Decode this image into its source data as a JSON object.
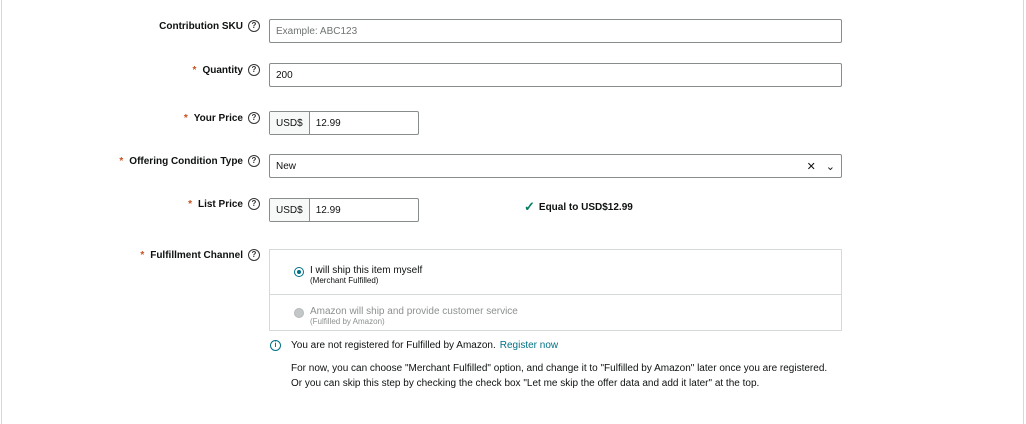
{
  "fields": {
    "sku": {
      "label": "Contribution SKU",
      "placeholder": "Example: ABC123"
    },
    "quantity": {
      "label": "Quantity",
      "value": "200"
    },
    "your_price": {
      "label": "Your Price",
      "currency": "USD$",
      "value": "12.99"
    },
    "condition": {
      "label": "Offering Condition Type",
      "value": "New"
    },
    "list_price": {
      "label": "List Price",
      "currency": "USD$",
      "value": "12.99",
      "note": "Equal to USD$12.99"
    },
    "fulfillment": {
      "label": "Fulfillment Channel",
      "options": [
        {
          "main": "I will ship this item myself",
          "sub": "(Merchant Fulfilled)",
          "selected": true
        },
        {
          "main": "Amazon will ship and provide customer service",
          "sub": "(Fulfilled by Amazon)",
          "selected": false
        }
      ]
    }
  },
  "info": {
    "text": "You are not registered for Fulfilled by Amazon.",
    "link": "Register now",
    "paragraph": "For now, you can choose \"Merchant Fulfilled\" option, and change it to \"Fulfilled by Amazon\" later once you are registered. Or you can skip this step by checking the check box \"Let me skip the offer data and add it later\" at the top."
  },
  "colors": {
    "link": "#007185",
    "required": "#c7511f",
    "success": "#067d62"
  }
}
